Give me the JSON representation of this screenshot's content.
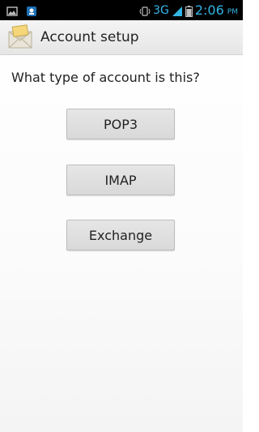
{
  "status_bar": {
    "network": "3G",
    "time": "2:06",
    "ampm": "PM",
    "icons": [
      "image-icon",
      "app-notification-icon",
      "vibrate-icon",
      "signal-icon",
      "battery-icon"
    ]
  },
  "action_bar": {
    "title": "Account setup",
    "icon": "email-envelope-icon"
  },
  "content": {
    "question": "What type of account is this?",
    "buttons": {
      "pop3": "POP3",
      "imap": "IMAP",
      "exchange": "Exchange"
    }
  },
  "colors": {
    "status_accent": "#33b5e5",
    "button_bg": "#dcdcdc",
    "action_bar_bg": "#eeeeee"
  }
}
